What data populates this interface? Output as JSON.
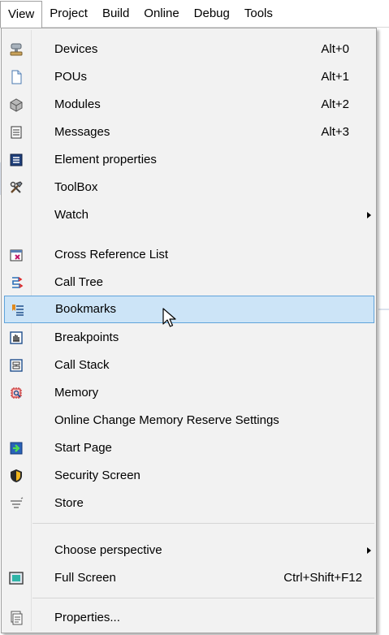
{
  "menubar": {
    "items": [
      "View",
      "Project",
      "Build",
      "Online",
      "Debug",
      "Tools"
    ]
  },
  "view_menu": {
    "items": [
      {
        "label": "Devices",
        "shortcut": "Alt+0",
        "icon": "devices-icon"
      },
      {
        "label": "POUs",
        "shortcut": "Alt+1",
        "icon": "pous-icon"
      },
      {
        "label": "Modules",
        "shortcut": "Alt+2",
        "icon": "modules-icon"
      },
      {
        "label": "Messages",
        "shortcut": "Alt+3",
        "icon": "messages-icon"
      },
      {
        "label": "Element properties",
        "icon": "element-properties-icon"
      },
      {
        "label": "ToolBox",
        "icon": "toolbox-icon"
      },
      {
        "label": "Watch",
        "submenu": true
      },
      {
        "label": "Cross Reference List",
        "icon": "cross-reference-icon"
      },
      {
        "label": "Call Tree",
        "icon": "call-tree-icon"
      },
      {
        "label": "Bookmarks",
        "icon": "bookmarks-icon",
        "highlighted": true
      },
      {
        "label": "Breakpoints",
        "icon": "breakpoints-icon"
      },
      {
        "label": "Call Stack",
        "icon": "call-stack-icon"
      },
      {
        "label": "Memory",
        "icon": "memory-icon"
      },
      {
        "label": "Online Change Memory Reserve Settings"
      },
      {
        "label": "Start Page",
        "icon": "start-page-icon"
      },
      {
        "label": "Security Screen",
        "icon": "security-screen-icon"
      },
      {
        "label": "Store",
        "icon": "store-icon"
      },
      {
        "label": "Choose perspective",
        "submenu": true
      },
      {
        "label": "Full Screen",
        "shortcut": "Ctrl+Shift+F12",
        "icon": "full-screen-icon"
      },
      {
        "label": "Properties...",
        "icon": "properties-icon"
      }
    ]
  },
  "colors": {
    "menu_background": "#f2f2f2",
    "highlight_fill": "#cce4f7",
    "highlight_border": "#5fa3db"
  }
}
